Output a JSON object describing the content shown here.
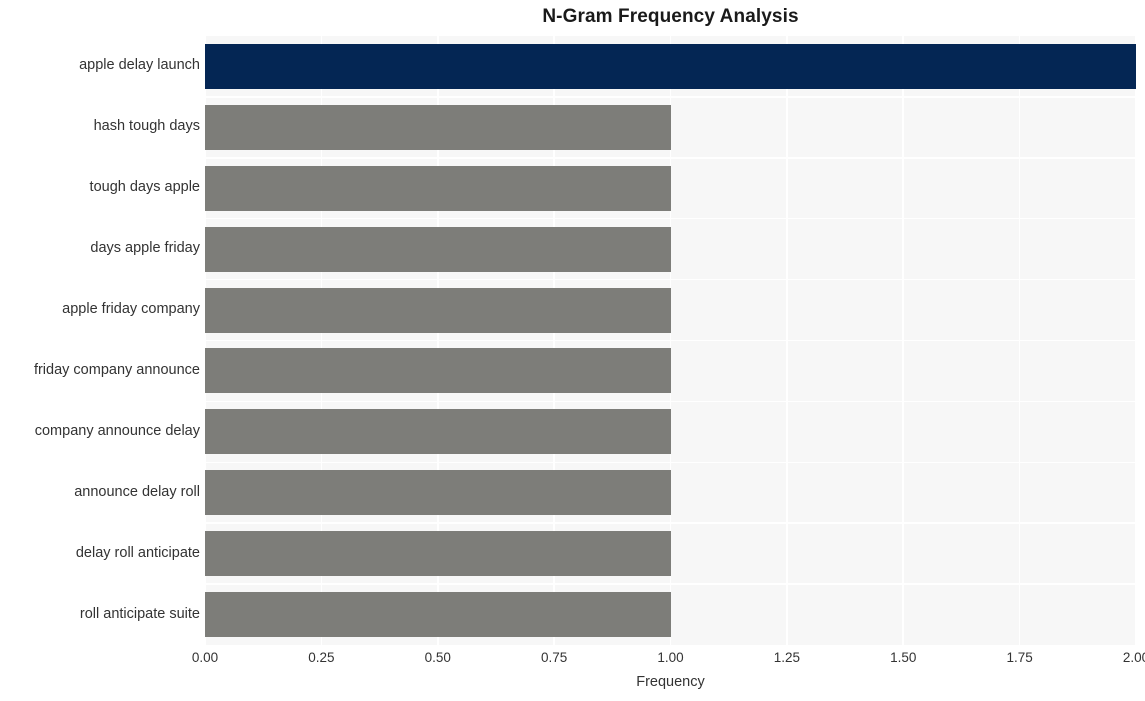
{
  "chart_data": {
    "type": "bar",
    "orientation": "horizontal",
    "title": "N-Gram Frequency Analysis",
    "xlabel": "Frequency",
    "ylabel": "",
    "categories": [
      "apple delay launch",
      "hash tough days",
      "tough days apple",
      "days apple friday",
      "apple friday company",
      "friday company announce",
      "company announce delay",
      "announce delay roll",
      "delay roll anticipate",
      "roll anticipate suite"
    ],
    "values": [
      2,
      1,
      1,
      1,
      1,
      1,
      1,
      1,
      1,
      1
    ],
    "bar_colors": [
      "#042654",
      "#7d7d79",
      "#7d7d79",
      "#7d7d79",
      "#7d7d79",
      "#7d7d79",
      "#7d7d79",
      "#7d7d79",
      "#7d7d79",
      "#7d7d79"
    ],
    "xlim": [
      0,
      2
    ],
    "xticks": [
      0,
      0.25,
      0.5,
      0.75,
      1.0,
      1.25,
      1.5,
      1.75,
      2.0
    ],
    "xticklabels": [
      "0.00",
      "0.25",
      "0.50",
      "0.75",
      "1.00",
      "1.25",
      "1.50",
      "1.75",
      "2.00"
    ],
    "grid": true,
    "legend": false,
    "plot_background": "#f7f7f7",
    "grid_color": "#ffffff",
    "figure_background": "#ffffff",
    "highlight_color": "#042654",
    "default_color": "#7d7d79"
  }
}
